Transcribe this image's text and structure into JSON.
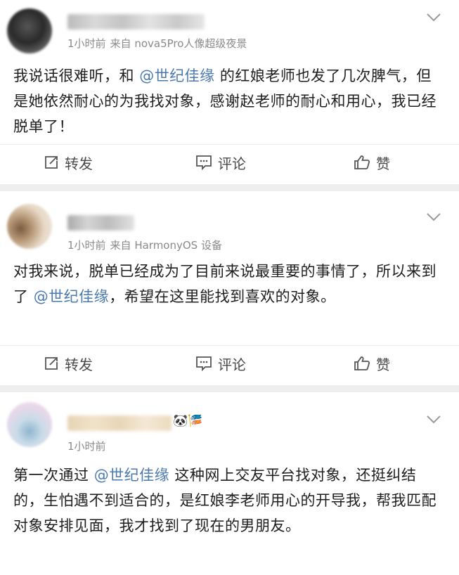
{
  "posts": [
    {
      "meta_time": "1小时前",
      "meta_source": "来自 nova5Pro人像超级夜景",
      "text_before": "我说话很难听，和 ",
      "mention": "@世纪佳缘",
      "text_after": " 的红娘老师也发了几次脾气，但是她依然耐心的为我找对象，感谢赵老师的耐心和用心，我已经脱单了！",
      "actions": {
        "repost": "转发",
        "comment": "评论",
        "like": "赞"
      }
    },
    {
      "meta_time": "1小时前",
      "meta_source": "来自 HarmonyOS 设备",
      "text_before": "对我来说，脱单已经成为了目前来说最重要的事情了，所以来到了 ",
      "mention": "@世纪佳缘",
      "text_after": "，希望在这里能找到喜欢的对象。",
      "actions": {
        "repost": "转发",
        "comment": "评论",
        "like": "赞"
      }
    },
    {
      "meta_time": "1小时前",
      "meta_source": "",
      "name_emoji": "🐼🎏",
      "text_before": "第一次通过 ",
      "mention": "@世纪佳缘",
      "text_after": " 这种网上交友平台找对象，还挺纠结的，生怕遇不到适合的，是红娘李老师用心的开导我，帮我匹配对象安排见面，我才找到了现在的男朋友。"
    }
  ],
  "colors": {
    "mention": "#4a79b0",
    "meta": "#8a8a8a",
    "separator": "#eeeeee"
  },
  "icons": [
    "repost-icon",
    "comment-icon",
    "like-icon",
    "chevron-down-icon"
  ]
}
